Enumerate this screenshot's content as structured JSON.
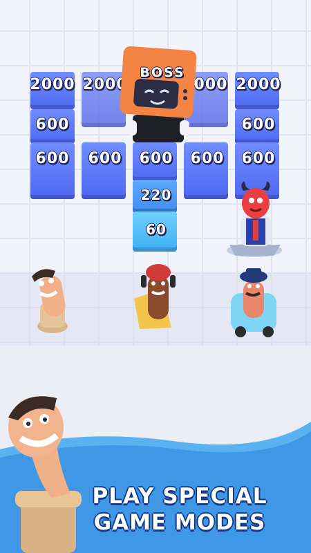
{
  "boss": {
    "label": "BOSS"
  },
  "board": {
    "tiles": [
      {
        "id": "c1-r1",
        "value": "2000"
      },
      {
        "id": "c2-r1",
        "value": "2000"
      },
      {
        "id": "c4-r1",
        "value": "000"
      },
      {
        "id": "c5-r1",
        "value": "2000"
      },
      {
        "id": "c1-r2",
        "value": "600"
      },
      {
        "id": "c5-r2",
        "value": "600"
      },
      {
        "id": "c1-r3",
        "value": "600"
      },
      {
        "id": "c2-r3",
        "value": "600"
      },
      {
        "id": "c3-r3",
        "value": "600"
      },
      {
        "id": "c4-r3",
        "value": "600"
      },
      {
        "id": "c5-r3",
        "value": "600"
      },
      {
        "id": "c3-r4",
        "value": "220"
      },
      {
        "id": "c3-r5",
        "value": "60"
      }
    ]
  },
  "promo": {
    "line1": "PLAY SPECIAL",
    "line2": "GAME MODES"
  },
  "colors": {
    "tile_blue": "#5872f4",
    "tile_cyan": "#4cbcf7",
    "boss_orange": "#f08044",
    "banner_blue": "#3f97e6"
  }
}
